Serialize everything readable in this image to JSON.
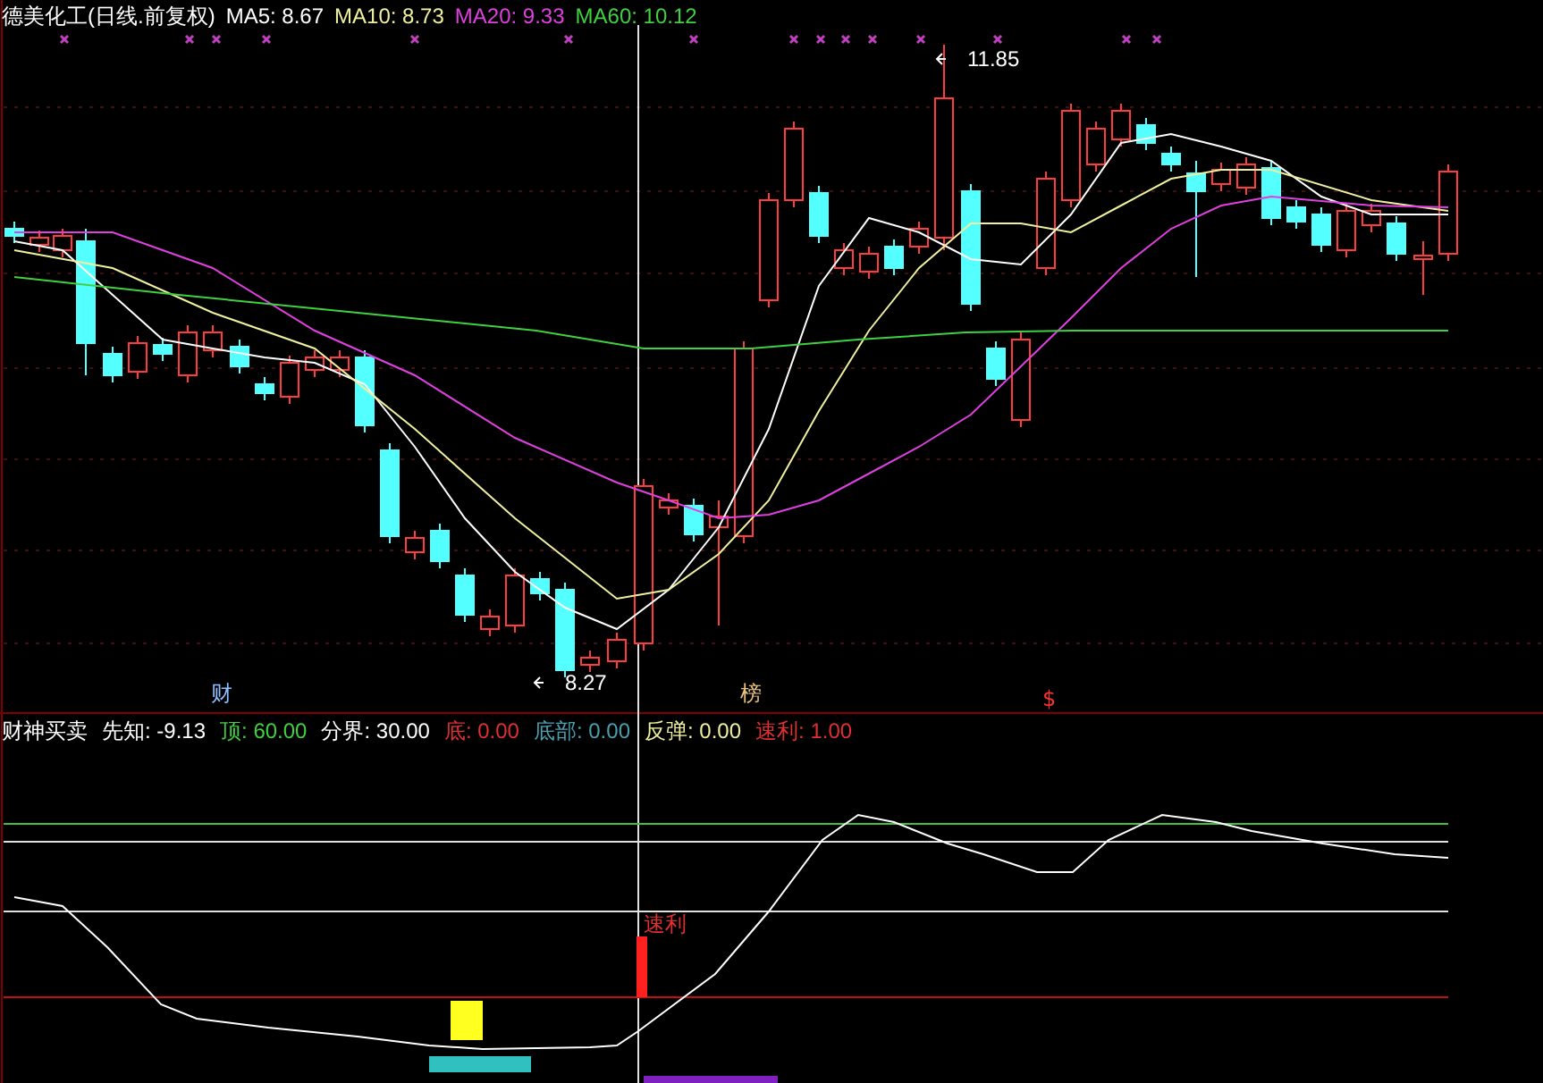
{
  "header": {
    "title": "德美化工(日线.前复权)",
    "ma": [
      {
        "label": "MA5: 8.67",
        "color": "#ffffff"
      },
      {
        "label": "MA10: 8.73",
        "color": "#f0f0a0"
      },
      {
        "label": "MA20: 9.33",
        "color": "#e040e0"
      },
      {
        "label": "MA60: 10.12",
        "color": "#40d040"
      }
    ]
  },
  "price_labels": [
    {
      "kind": "high",
      "text": "11.85"
    },
    {
      "kind": "low",
      "text": "8.27"
    }
  ],
  "markers": [
    {
      "text": "财",
      "color": "#8fbfff"
    },
    {
      "text": "榜",
      "color": "#e8c080"
    },
    {
      "text": "$",
      "color": "#ff3030"
    }
  ],
  "indicator": {
    "name": "财神买卖",
    "fields": [
      {
        "label": "先知: -9.13",
        "color": "#ffffff"
      },
      {
        "label": "顶: 60.00",
        "color": "#40d040"
      },
      {
        "label": "分界: 30.00",
        "color": "#ffffff"
      },
      {
        "label": "底: 0.00",
        "color": "#e03030"
      },
      {
        "label": "底部: 0.00",
        "color": "#4aa0b0"
      },
      {
        "label": "反弹: 0.00",
        "color": "#f0f0a0"
      },
      {
        "label": "速利: 1.00",
        "color": "#e03030"
      }
    ],
    "signal_label": "速利"
  }
}
